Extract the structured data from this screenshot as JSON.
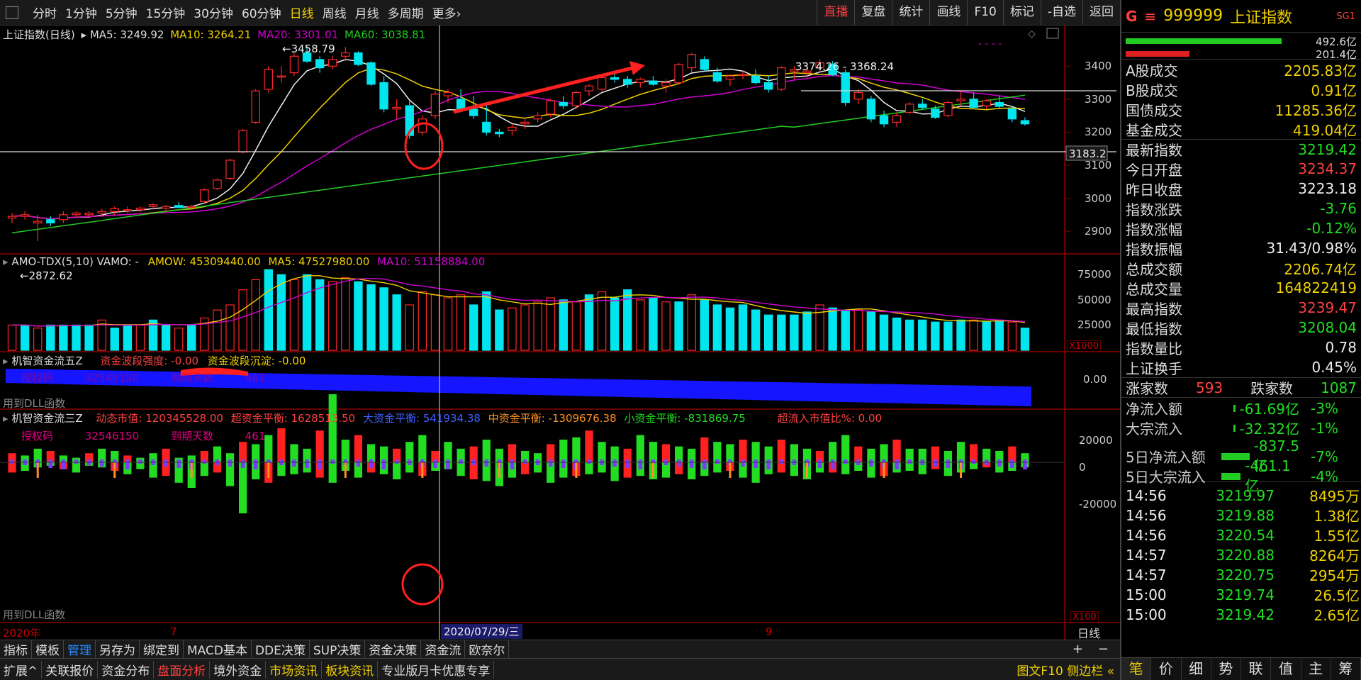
{
  "periods": [
    "分时",
    "1分钟",
    "5分钟",
    "15分钟",
    "30分钟",
    "60分钟",
    "日线",
    "周线",
    "月线",
    "多周期",
    "更多›"
  ],
  "active_period": "日线",
  "toolbar": [
    "直播",
    "复盘",
    "统计",
    "画线",
    "F10",
    "标记",
    "-自选",
    "返回"
  ],
  "main_legend": {
    "name": "上证指数(日线)",
    "ma5": "MA5: 3249.92",
    "ma10": "MA10: 3264.21",
    "ma20": "MA20: 3301.01",
    "ma60": "MA60: 3038.81"
  },
  "annotations": {
    "high": "3458.79",
    "low": "2872.62",
    "range": "3374.26 - 3368.24",
    "crosshair_price": "3183.2",
    "crosshair_date": "2020/07/29/三"
  },
  "price_axis": [
    "3400",
    "3300",
    "3200",
    "3100",
    "3000",
    "2900"
  ],
  "vol_legend": {
    "name": "AMO-TDX(5,10) VAMO: -",
    "amow": "AMOW: 45309440.00",
    "ma5": "MA5: 47527980.00",
    "ma10": "MA10: 51158884.00"
  },
  "vol_axis": [
    "75000",
    "50000",
    "25000"
  ],
  "vol_unit": "X1000",
  "flow5_legend": {
    "name": "机智资金流五Z",
    "strength": "资金波段强度: -0.00",
    "sink": "资金波段沉淀: -0.00"
  },
  "flow5_axis": "0.00",
  "flow5_overlay": {
    "code_label": "授权码",
    "code": "32546150",
    "expiry_label": "到期天数",
    "expiry": "461"
  },
  "dll_text": "用到DLL函数",
  "flow3_legend": {
    "name": "机智资金流三Z",
    "mcap": "动态市值: 120345528.00",
    "super": "超资金平衡: 1628513.50",
    "big": "大资金平衡: 541934.38",
    "mid": "中资金平衡: -1309676.38",
    "small": "小资金平衡: -831869.75",
    "ratio": "超流入市值比%: 0.00"
  },
  "flow3_axis": [
    "20000",
    "0",
    "-20000"
  ],
  "flow3_overlay": {
    "code_label": "授权码",
    "code": "32546150",
    "expiry_label": "到期天数",
    "expiry": "461"
  },
  "flow3_unit": "X100",
  "date_axis": {
    "year": "2020年",
    "m7": "7",
    "m9": "9",
    "period": "日线"
  },
  "bottom_tabs1": [
    "指标",
    "模板",
    "管理",
    "另存为",
    "绑定到",
    "MACD基本",
    "DDE决策",
    "SUP决策",
    "资金决策",
    "资金流",
    "欧奈尔"
  ],
  "bottom_tabs2": [
    "扩展^",
    "关联报价",
    "资金分布",
    "盘面分析",
    "境外资金",
    "市场资讯",
    "板块资讯",
    "专业版月卡优惠专享"
  ],
  "bottom_right": "图文F10 侧边栏 «",
  "zoom": {
    "plus": "+",
    "minus": "−"
  },
  "right_panel": {
    "g": "G",
    "menu": "≡",
    "code": "999999",
    "name": "上证指数",
    "tag": "SG1",
    "bar_vals": [
      "492.6亿",
      "201.4亿"
    ],
    "stats": [
      {
        "label": "A股成交",
        "value": "2205.83亿",
        "color": "#f0d000"
      },
      {
        "label": "B股成交",
        "value": "0.91亿",
        "color": "#f0d000"
      },
      {
        "label": "国债成交",
        "value": "11285.36亿",
        "color": "#f0d000"
      },
      {
        "label": "基金成交",
        "value": "419.04亿",
        "color": "#f0d000"
      },
      {
        "label": "最新指数",
        "value": "3219.42",
        "color": "#22dd22"
      },
      {
        "label": "今日开盘",
        "value": "3234.37",
        "color": "#ff4040"
      },
      {
        "label": "昨日收盘",
        "value": "3223.18",
        "color": "#eeeeee"
      },
      {
        "label": "指数涨跌",
        "value": "-3.76",
        "color": "#22dd22"
      },
      {
        "label": "指数涨幅",
        "value": "-0.12%",
        "color": "#22dd22"
      },
      {
        "label": "指数振幅",
        "value": "31.43/0.98%",
        "color": "#eeeeee"
      },
      {
        "label": "总成交额",
        "value": "2206.74亿",
        "color": "#f0d000"
      },
      {
        "label": "总成交量",
        "value": "164822419",
        "color": "#f0d000"
      },
      {
        "label": "最高指数",
        "value": "3239.47",
        "color": "#ff4040"
      },
      {
        "label": "最低指数",
        "value": "3208.04",
        "color": "#22dd22"
      },
      {
        "label": "指数量比",
        "value": "0.78",
        "color": "#eeeeee"
      },
      {
        "label": "上证换手",
        "value": "0.45%",
        "color": "#eeeeee"
      }
    ],
    "updown": {
      "up_label": "涨家数",
      "up": "593",
      "down_label": "跌家数",
      "down": "1087"
    },
    "flows": [
      {
        "label": "净流入额",
        "value": "-61.69亿",
        "pct": "-3%",
        "bar": 0.02
      },
      {
        "label": "大宗流入",
        "value": "-32.32亿",
        "pct": "-1%",
        "bar": 0.02
      },
      {
        "label": "5日净流入额",
        "value": "-837.5亿",
        "pct": "-7%",
        "bar": 0.9
      },
      {
        "label": "5日大宗流入",
        "value": "-461.1亿",
        "pct": "-4%",
        "bar": 0.5
      }
    ],
    "ticks": [
      {
        "time": "14:56",
        "price": "3219.97",
        "vol": "8495万"
      },
      {
        "time": "14:56",
        "price": "3219.88",
        "vol": "1.38亿"
      },
      {
        "time": "14:56",
        "price": "3220.54",
        "vol": "1.55亿"
      },
      {
        "time": "14:57",
        "price": "3220.88",
        "vol": "8264万"
      },
      {
        "time": "14:57",
        "price": "3220.75",
        "vol": "2954万"
      },
      {
        "time": "15:00",
        "price": "3219.74",
        "vol": "26.5亿"
      },
      {
        "time": "15:00",
        "price": "3219.42",
        "vol": "2.65亿"
      }
    ],
    "tabs": [
      "笔",
      "价",
      "细",
      "势",
      "联",
      "值",
      "主",
      "筹"
    ]
  },
  "chart_data": {
    "type": "candlestick",
    "ohlc": [
      [
        2940,
        2955,
        2925,
        2945
      ],
      [
        2945,
        2960,
        2935,
        2950
      ],
      [
        2925,
        2950,
        2870,
        2930
      ],
      [
        2935,
        2945,
        2915,
        2925
      ],
      [
        2935,
        2960,
        2925,
        2950
      ],
      [
        2950,
        2960,
        2940,
        2955
      ],
      [
        2950,
        2960,
        2940,
        2955
      ],
      [
        2955,
        2968,
        2945,
        2960
      ],
      [
        2960,
        2975,
        2950,
        2968
      ],
      [
        2962,
        2975,
        2955,
        2965
      ],
      [
        2965,
        2975,
        2958,
        2970
      ],
      [
        2975,
        2985,
        2965,
        2980
      ],
      [
        2970,
        2980,
        2960,
        2975
      ],
      [
        2978,
        2988,
        2970,
        2972
      ],
      [
        2972,
        2980,
        2965,
        2975
      ],
      [
        2990,
        3030,
        2985,
        3025
      ],
      [
        3030,
        3060,
        3025,
        3055
      ],
      [
        3060,
        3120,
        3055,
        3115
      ],
      [
        3140,
        3210,
        3135,
        3205
      ],
      [
        3230,
        3330,
        3225,
        3325
      ],
      [
        3330,
        3400,
        3320,
        3390
      ],
      [
        3370,
        3400,
        3350,
        3370
      ],
      [
        3380,
        3440,
        3370,
        3430
      ],
      [
        3440,
        3460,
        3410,
        3415
      ],
      [
        3420,
        3430,
        3380,
        3395
      ],
      [
        3400,
        3430,
        3390,
        3420
      ],
      [
        3430,
        3458,
        3415,
        3440
      ],
      [
        3440,
        3445,
        3400,
        3405
      ],
      [
        3410,
        3415,
        3340,
        3345
      ],
      [
        3350,
        3370,
        3260,
        3270
      ],
      [
        3270,
        3300,
        3240,
        3275
      ],
      [
        3280,
        3295,
        3180,
        3190
      ],
      [
        3200,
        3250,
        3190,
        3240
      ],
      [
        3250,
        3325,
        3240,
        3315
      ],
      [
        3310,
        3330,
        3290,
        3320
      ],
      [
        3300,
        3330,
        3260,
        3270
      ],
      [
        3270,
        3310,
        3240,
        3250
      ],
      [
        3230,
        3285,
        3190,
        3200
      ],
      [
        3200,
        3210,
        3185,
        3195
      ],
      [
        3205,
        3225,
        3190,
        3215
      ],
      [
        3225,
        3240,
        3210,
        3230
      ],
      [
        3240,
        3260,
        3230,
        3250
      ],
      [
        3255,
        3300,
        3245,
        3295
      ],
      [
        3290,
        3310,
        3270,
        3280
      ],
      [
        3280,
        3325,
        3270,
        3320
      ],
      [
        3325,
        3345,
        3310,
        3340
      ],
      [
        3330,
        3370,
        3325,
        3365
      ],
      [
        3365,
        3380,
        3350,
        3360
      ],
      [
        3360,
        3370,
        3335,
        3345
      ],
      [
        3350,
        3365,
        3335,
        3360
      ],
      [
        3355,
        3370,
        3340,
        3345
      ],
      [
        3340,
        3360,
        3320,
        3350
      ],
      [
        3350,
        3410,
        3345,
        3405
      ],
      [
        3395,
        3440,
        3380,
        3435
      ],
      [
        3420,
        3430,
        3385,
        3390
      ],
      [
        3380,
        3395,
        3350,
        3355
      ],
      [
        3360,
        3375,
        3340,
        3370
      ],
      [
        3375,
        3385,
        3360,
        3375
      ],
      [
        3370,
        3390,
        3345,
        3350
      ],
      [
        3350,
        3370,
        3320,
        3330
      ],
      [
        3330,
        3400,
        3325,
        3395
      ],
      [
        3385,
        3400,
        3360,
        3390
      ],
      [
        3380,
        3400,
        3365,
        3385
      ],
      [
        3395,
        3420,
        3380,
        3410
      ],
      [
        3405,
        3415,
        3370,
        3375
      ],
      [
        3380,
        3390,
        3280,
        3290
      ],
      [
        3300,
        3330,
        3285,
        3320
      ],
      [
        3300,
        3310,
        3230,
        3240
      ],
      [
        3250,
        3265,
        3215,
        3225
      ],
      [
        3230,
        3260,
        3215,
        3250
      ],
      [
        3260,
        3290,
        3255,
        3285
      ],
      [
        3285,
        3300,
        3270,
        3275
      ],
      [
        3270,
        3280,
        3240,
        3245
      ],
      [
        3250,
        3295,
        3245,
        3290
      ],
      [
        3295,
        3325,
        3280,
        3300
      ],
      [
        3300,
        3320,
        3270,
        3275
      ],
      [
        3280,
        3300,
        3270,
        3295
      ],
      [
        3290,
        3310,
        3270,
        3278
      ],
      [
        3270,
        3280,
        3230,
        3240
      ],
      [
        3235,
        3245,
        3220,
        3225
      ]
    ],
    "volume": [
      [
        25000,
        0
      ],
      [
        25000,
        1
      ],
      [
        22000,
        0
      ],
      [
        25000,
        1
      ],
      [
        25000,
        1
      ],
      [
        25000,
        1
      ],
      [
        25000,
        1
      ],
      [
        30000,
        0
      ],
      [
        22000,
        1
      ],
      [
        25000,
        1
      ],
      [
        25000,
        0
      ],
      [
        30000,
        1
      ],
      [
        25000,
        1
      ],
      [
        22000,
        0
      ],
      [
        25000,
        1
      ],
      [
        32000,
        0
      ],
      [
        40000,
        0
      ],
      [
        45000,
        0
      ],
      [
        60000,
        0
      ],
      [
        70000,
        0
      ],
      [
        80000,
        1
      ],
      [
        75000,
        1
      ],
      [
        70000,
        0
      ],
      [
        75000,
        1
      ],
      [
        70000,
        1
      ],
      [
        68000,
        0
      ],
      [
        72000,
        0
      ],
      [
        68000,
        1
      ],
      [
        65000,
        1
      ],
      [
        62000,
        1
      ],
      [
        55000,
        1
      ],
      [
        45000,
        0
      ],
      [
        58000,
        0
      ],
      [
        55000,
        0
      ],
      [
        52000,
        0
      ],
      [
        55000,
        0
      ],
      [
        45000,
        1
      ],
      [
        58000,
        1
      ],
      [
        40000,
        1
      ],
      [
        42000,
        0
      ],
      [
        45000,
        0
      ],
      [
        48000,
        0
      ],
      [
        52000,
        0
      ],
      [
        50000,
        1
      ],
      [
        48000,
        0
      ],
      [
        55000,
        1
      ],
      [
        58000,
        0
      ],
      [
        52000,
        1
      ],
      [
        60000,
        1
      ],
      [
        50000,
        0
      ],
      [
        52000,
        1
      ],
      [
        48000,
        0
      ],
      [
        48000,
        1
      ],
      [
        55000,
        0
      ],
      [
        50000,
        1
      ],
      [
        45000,
        1
      ],
      [
        42000,
        1
      ],
      [
        45000,
        1
      ],
      [
        40000,
        1
      ],
      [
        35000,
        1
      ],
      [
        35000,
        1
      ],
      [
        35000,
        1
      ],
      [
        38000,
        1
      ],
      [
        45000,
        0
      ],
      [
        42000,
        1
      ],
      [
        40000,
        1
      ],
      [
        40000,
        0
      ],
      [
        38000,
        1
      ],
      [
        35000,
        1
      ],
      [
        32000,
        1
      ],
      [
        30000,
        1
      ],
      [
        30000,
        1
      ],
      [
        28000,
        1
      ],
      [
        28000,
        1
      ],
      [
        30000,
        1
      ],
      [
        30000,
        0
      ],
      [
        28000,
        1
      ],
      [
        30000,
        1
      ],
      [
        28000,
        0
      ],
      [
        22000,
        1
      ]
    ],
    "price_range": [
      2840,
      3480
    ],
    "volume_range": [
      0,
      90000
    ]
  }
}
